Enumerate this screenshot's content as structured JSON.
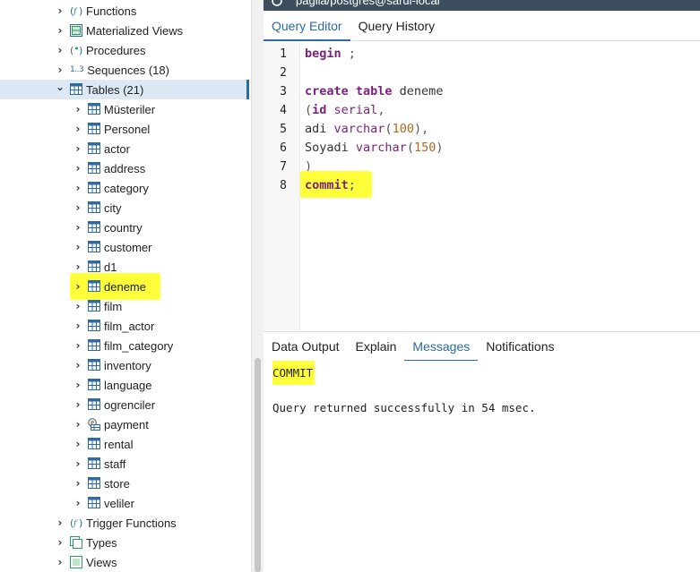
{
  "tree": {
    "items": [
      {
        "label": "Functions",
        "icon": "function-icon",
        "level": 0,
        "expanded": false
      },
      {
        "label": "Materialized Views",
        "icon": "materialized-view-icon",
        "level": 0,
        "expanded": false
      },
      {
        "label": "Procedures",
        "icon": "procedure-icon",
        "level": 0,
        "expanded": false
      },
      {
        "label": "Sequences (18)",
        "icon": "sequence-icon",
        "icon_text": "1..3",
        "level": 0,
        "expanded": false
      },
      {
        "label": "Tables (21)",
        "icon": "table-icon",
        "level": 0,
        "expanded": true,
        "selected": true
      },
      {
        "label": "Müsteriler",
        "icon": "table-icon",
        "level": 1
      },
      {
        "label": "Personel",
        "icon": "table-icon",
        "level": 1
      },
      {
        "label": "actor",
        "icon": "table-icon",
        "level": 1
      },
      {
        "label": "address",
        "icon": "table-icon",
        "level": 1
      },
      {
        "label": "category",
        "icon": "table-icon",
        "level": 1
      },
      {
        "label": "city",
        "icon": "table-icon",
        "level": 1
      },
      {
        "label": "country",
        "icon": "table-icon",
        "level": 1
      },
      {
        "label": "customer",
        "icon": "table-icon",
        "level": 1
      },
      {
        "label": "d1",
        "icon": "table-icon",
        "level": 1
      },
      {
        "label": "deneme",
        "icon": "table-icon",
        "level": 1,
        "highlighted": true
      },
      {
        "label": "film",
        "icon": "table-icon",
        "level": 1
      },
      {
        "label": "film_actor",
        "icon": "table-icon",
        "level": 1
      },
      {
        "label": "film_category",
        "icon": "table-icon",
        "level": 1
      },
      {
        "label": "inventory",
        "icon": "table-icon",
        "level": 1
      },
      {
        "label": "language",
        "icon": "table-icon",
        "level": 1
      },
      {
        "label": "ogrenciler",
        "icon": "table-icon",
        "level": 1
      },
      {
        "label": "payment",
        "icon": "partitioned-table-icon",
        "level": 1
      },
      {
        "label": "rental",
        "icon": "table-icon",
        "level": 1
      },
      {
        "label": "staff",
        "icon": "table-icon",
        "level": 1
      },
      {
        "label": "store",
        "icon": "table-icon",
        "level": 1
      },
      {
        "label": "veliler",
        "icon": "table-icon",
        "level": 1
      },
      {
        "label": "Trigger Functions",
        "icon": "trigger-function-icon",
        "level": 0,
        "expanded": false
      },
      {
        "label": "Types",
        "icon": "type-icon",
        "level": 0,
        "expanded": false
      },
      {
        "label": "Views",
        "icon": "view-icon",
        "level": 0,
        "expanded": false
      }
    ]
  },
  "window": {
    "title": "pagila/postgres@sarul-local",
    "title_icon": "query-tool-icon"
  },
  "editor_tabs": [
    {
      "label": "Query Editor",
      "active": true
    },
    {
      "label": "Query History",
      "active": false
    }
  ],
  "editor": {
    "line_numbers": [
      "1",
      "2",
      "3",
      "4",
      "5",
      "6",
      "7",
      "8"
    ],
    "lines": [
      [
        {
          "t": "begin",
          "c": "kw"
        },
        {
          "t": " ;",
          "c": "pn"
        }
      ],
      [],
      [
        {
          "t": "create table",
          "c": "kw"
        },
        {
          "t": " deneme",
          "c": ""
        }
      ],
      [
        {
          "t": "(",
          "c": "pn"
        },
        {
          "t": "id",
          "c": "kw"
        },
        {
          "t": " serial",
          "c": "ty"
        },
        {
          "t": ",",
          "c": "pn"
        }
      ],
      [
        {
          "t": "adi ",
          "c": ""
        },
        {
          "t": "varchar",
          "c": "ty"
        },
        {
          "t": "(",
          "c": "pn"
        },
        {
          "t": "100",
          "c": "num"
        },
        {
          "t": "),",
          "c": "pn"
        }
      ],
      [
        {
          "t": "Soyadi ",
          "c": ""
        },
        {
          "t": "varchar",
          "c": "ty"
        },
        {
          "t": "(",
          "c": "pn"
        },
        {
          "t": "150",
          "c": "num"
        },
        {
          "t": ")",
          "c": "pn"
        }
      ],
      [
        {
          "t": ")",
          "c": "pn"
        }
      ],
      [
        {
          "t": "commit",
          "c": "kw"
        },
        {
          "t": ";",
          "c": "pn"
        }
      ]
    ],
    "highlighted_line": 8
  },
  "output_tabs": [
    {
      "label": "Data Output",
      "active": false
    },
    {
      "label": "Explain",
      "active": false
    },
    {
      "label": "Messages",
      "active": true
    },
    {
      "label": "Notifications",
      "active": false
    }
  ],
  "messages": {
    "line1": "COMMIT",
    "line2": "Query returned successfully in 54 msec."
  },
  "colors": {
    "accent": "#2c6aa0",
    "highlight": "#ffff3a",
    "keyword": "#7d1f7e",
    "number": "#b5651d",
    "titlebar": "#3d4f5e"
  }
}
